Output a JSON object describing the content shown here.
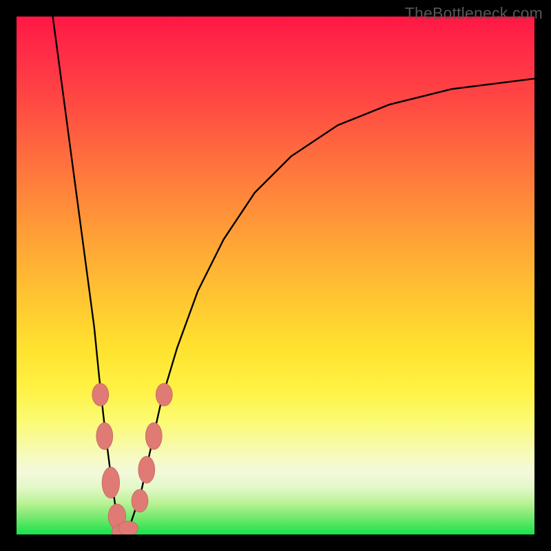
{
  "watermark": "TheBottleneck.com",
  "colors": {
    "bead_fill": "#df7a75",
    "bead_stroke": "#c05a56",
    "curve": "#000000",
    "frame_bg": "#000000"
  },
  "chart_data": {
    "type": "line",
    "title": "",
    "xlabel": "",
    "ylabel": "",
    "xlim": [
      0,
      100
    ],
    "ylim": [
      0,
      100
    ],
    "series": [
      {
        "name": "bottleneck-curve",
        "x": [
          7,
          9,
          11,
          13,
          15,
          16,
          17,
          18,
          19,
          19.8,
          20.7,
          22,
          24,
          26,
          28,
          31,
          35,
          40,
          46,
          53,
          62,
          72,
          84,
          100
        ],
        "y": [
          100,
          85,
          70,
          55,
          40,
          30,
          21,
          13,
          6,
          1.5,
          0.5,
          2,
          8,
          17,
          26,
          36,
          47,
          57,
          66,
          73,
          79,
          83,
          86,
          88
        ]
      }
    ],
    "markers": [
      {
        "x": 16.2,
        "y": 27,
        "rx": 1.6,
        "ry": 2.2
      },
      {
        "x": 17.0,
        "y": 19,
        "rx": 1.6,
        "ry": 2.6
      },
      {
        "x": 18.2,
        "y": 10,
        "rx": 1.7,
        "ry": 3.0
      },
      {
        "x": 19.4,
        "y": 3.5,
        "rx": 1.7,
        "ry": 2.4
      },
      {
        "x": 20.4,
        "y": 0.6,
        "rx": 2.0,
        "ry": 1.4
      },
      {
        "x": 21.6,
        "y": 1.2,
        "rx": 1.9,
        "ry": 1.4
      },
      {
        "x": 23.8,
        "y": 6.5,
        "rx": 1.6,
        "ry": 2.2
      },
      {
        "x": 25.1,
        "y": 12.5,
        "rx": 1.6,
        "ry": 2.6
      },
      {
        "x": 26.5,
        "y": 19,
        "rx": 1.6,
        "ry": 2.6
      },
      {
        "x": 28.5,
        "y": 27,
        "rx": 1.6,
        "ry": 2.2
      }
    ]
  }
}
